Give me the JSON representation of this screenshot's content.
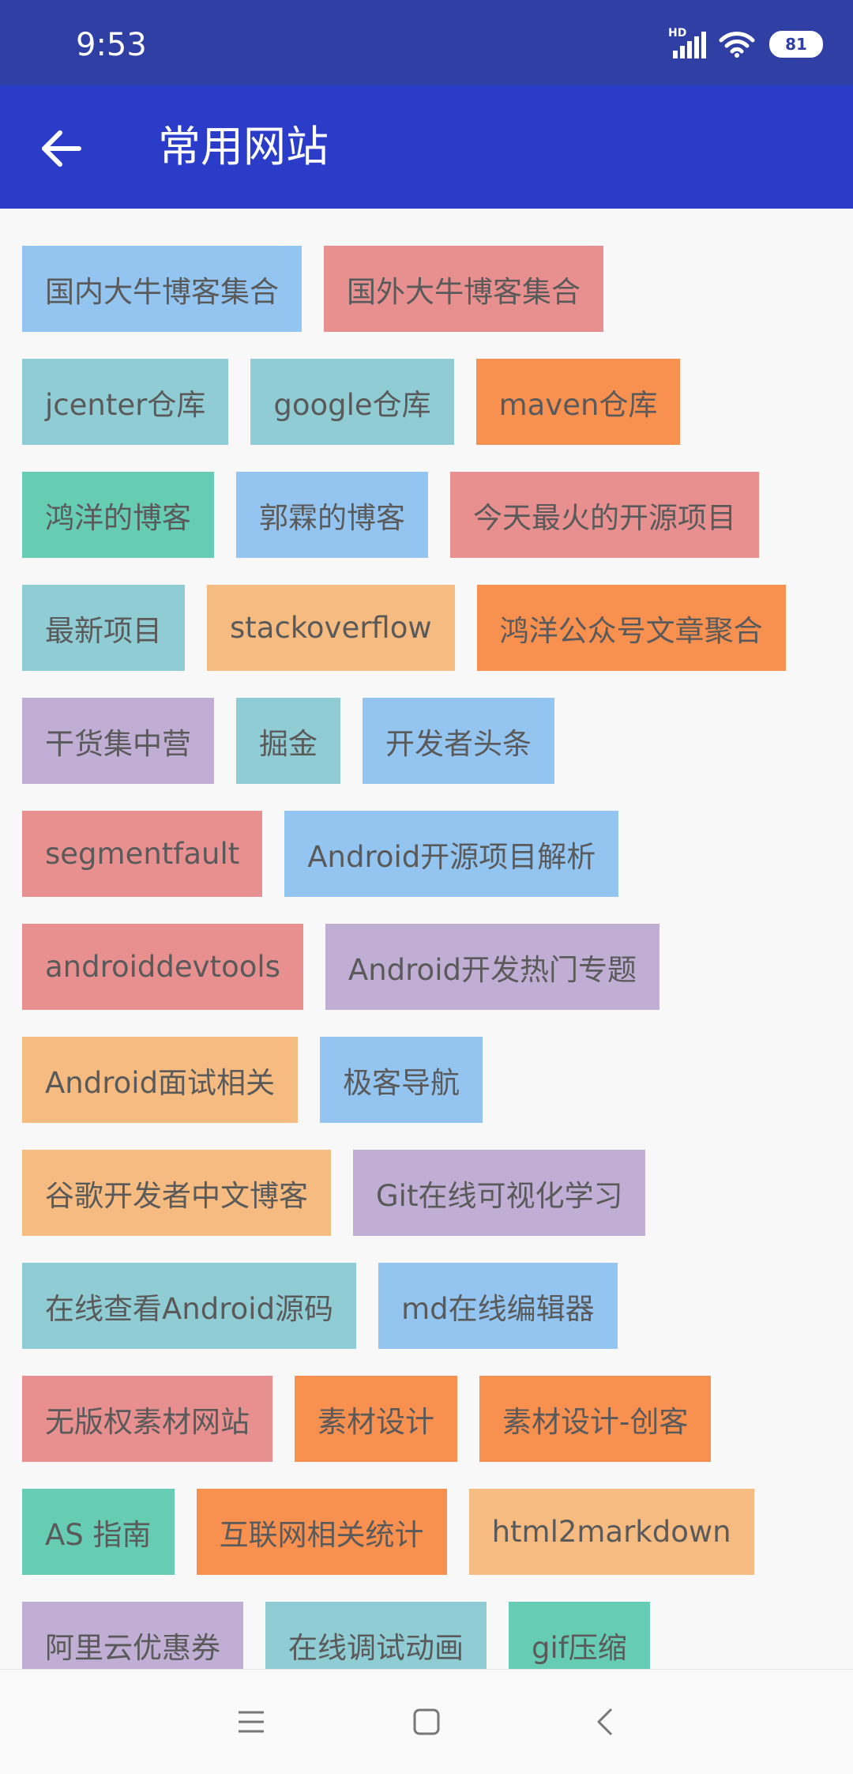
{
  "status_bar": {
    "time": "9:53",
    "network_label": "HD",
    "battery": "81",
    "icons": [
      "signal-icon",
      "wifi-icon",
      "battery-icon"
    ]
  },
  "app_bar": {
    "title": "常用网站",
    "back_icon": "arrow-left-icon",
    "color": "#2a3cc8"
  },
  "palette": {
    "blue": "#93c5f0",
    "red": "#e89090",
    "teal": "#90ccd4",
    "orange": "#f89050",
    "green": "#66ccb4",
    "peach": "#f6bb80",
    "purple": "#c0aed4"
  },
  "rows": [
    [
      {
        "label": "国内大牛博客集合",
        "color": "blue"
      },
      {
        "label": "国外大牛博客集合",
        "color": "red"
      }
    ],
    [
      {
        "label": "jcenter仓库",
        "color": "teal"
      },
      {
        "label": "google仓库",
        "color": "teal"
      },
      {
        "label": "maven仓库",
        "color": "orange"
      }
    ],
    [
      {
        "label": "鸿洋的博客",
        "color": "green"
      },
      {
        "label": "郭霖的博客",
        "color": "blue"
      },
      {
        "label": "今天最火的开源项目",
        "color": "red"
      }
    ],
    [
      {
        "label": "最新项目",
        "color": "teal"
      },
      {
        "label": "stackoverflow",
        "color": "peach"
      },
      {
        "label": "鸿洋公众号文章聚合",
        "color": "orange"
      }
    ],
    [
      {
        "label": "干货集中营",
        "color": "purple"
      },
      {
        "label": "掘金",
        "color": "teal"
      },
      {
        "label": "开发者头条",
        "color": "blue"
      }
    ],
    [
      {
        "label": "segmentfault",
        "color": "red"
      },
      {
        "label": "Android开源项目解析",
        "color": "blue"
      }
    ],
    [
      {
        "label": "androiddevtools",
        "color": "red"
      },
      {
        "label": "Android开发热门专题",
        "color": "purple"
      }
    ],
    [
      {
        "label": "Android面试相关",
        "color": "peach"
      },
      {
        "label": "极客导航",
        "color": "blue"
      }
    ],
    [
      {
        "label": "谷歌开发者中文博客",
        "color": "peach"
      },
      {
        "label": "Git在线可视化学习",
        "color": "purple"
      }
    ],
    [
      {
        "label": "在线查看Android源码",
        "color": "teal"
      },
      {
        "label": "md在线编辑器",
        "color": "blue"
      }
    ],
    [
      {
        "label": "无版权素材网站",
        "color": "red"
      },
      {
        "label": "素材设计",
        "color": "orange"
      },
      {
        "label": "素材设计-创客",
        "color": "orange"
      }
    ],
    [
      {
        "label": "AS 指南",
        "color": "green"
      },
      {
        "label": "互联网相关统计",
        "color": "orange"
      },
      {
        "label": "html2markdown",
        "color": "peach"
      }
    ],
    [
      {
        "label": "阿里云优惠券",
        "color": "purple"
      },
      {
        "label": "在线调试动画",
        "color": "teal"
      },
      {
        "label": "gif压缩",
        "color": "green"
      }
    ]
  ],
  "nav_bar": {
    "icons": [
      "menu-icon",
      "home-square-icon",
      "back-chevron-icon"
    ]
  }
}
